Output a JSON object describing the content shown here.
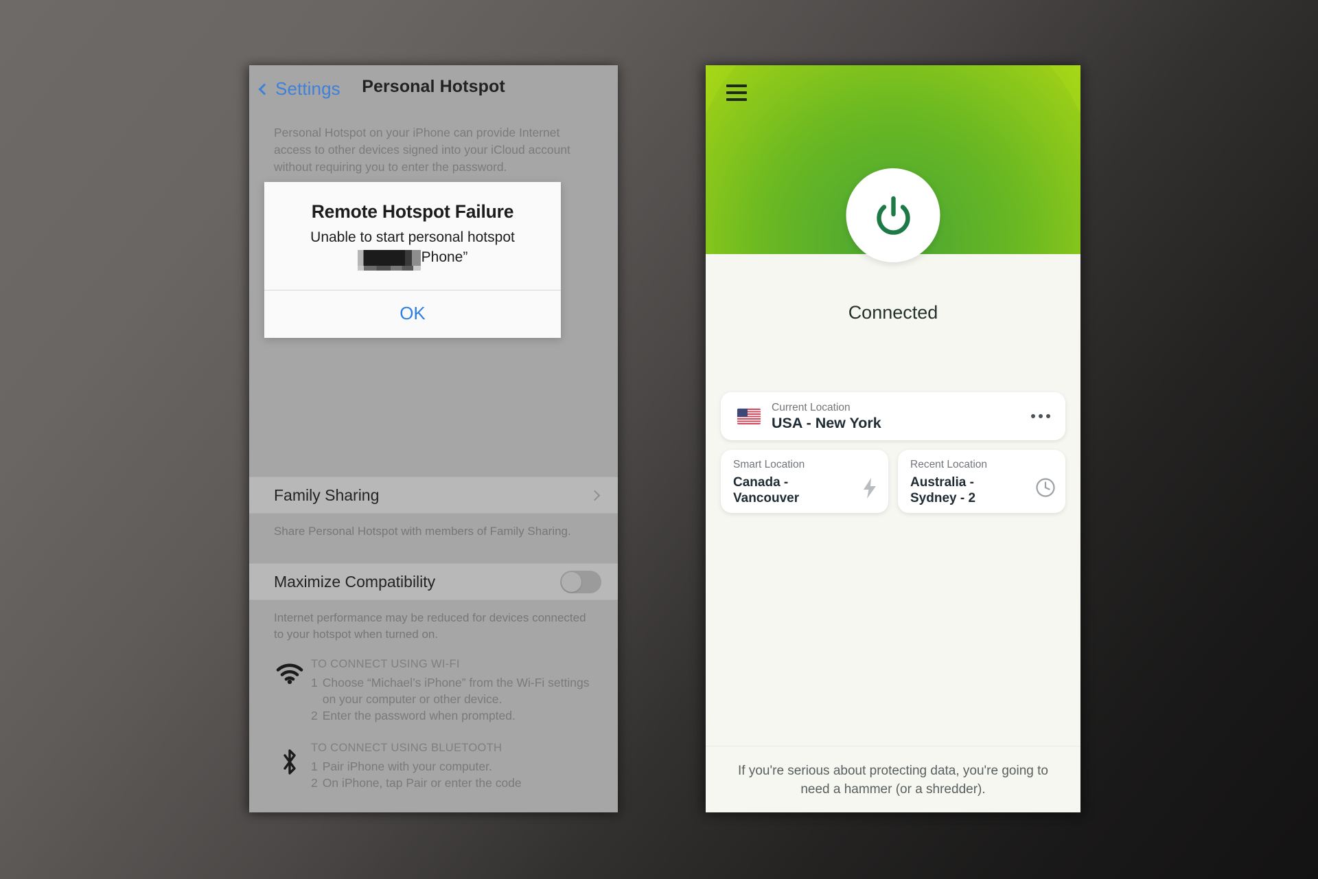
{
  "ios_settings": {
    "nav": {
      "back_label": "Settings",
      "title": "Personal Hotspot",
      "back_icon": "chevron-left-icon"
    },
    "intro": "Personal Hotspot on your iPhone can provide Internet access to other devices signed into your iCloud account without requiring you to enter the password.",
    "alert": {
      "title": "Remote Hotspot Failure",
      "message_line1": "Unable to start personal hotspot",
      "message_line2_suffix": "Phone”",
      "ok_label": "OK"
    },
    "family_sharing": {
      "label": "Family Sharing",
      "footnote": "Share Personal Hotspot with members of Family Sharing."
    },
    "maximize_compatibility": {
      "label": "Maximize Compatibility",
      "toggle_state": "off",
      "footnote": "Internet performance may be reduced for devices connected to your hotspot when turned on."
    },
    "wifi_block": {
      "icon": "wifi-icon",
      "heading": "TO CONNECT USING WI-FI",
      "steps": [
        {
          "num": "1",
          "text": "Choose “Michael’s iPhone” from the Wi-Fi settings on your computer or other device."
        },
        {
          "num": "2",
          "text": "Enter the password when prompted."
        }
      ]
    },
    "bluetooth_block": {
      "icon": "bluetooth-icon",
      "heading": "TO CONNECT USING BLUETOOTH",
      "steps": [
        {
          "num": "1",
          "text": "Pair iPhone with your computer."
        },
        {
          "num": "2",
          "text": "On iPhone, tap Pair or enter the code"
        }
      ]
    }
  },
  "vpn_app": {
    "menu_icon": "hamburger-menu-icon",
    "power_icon": "power-button-icon",
    "status": "Connected",
    "current_location": {
      "label": "Current Location",
      "value": "USA - New York",
      "flag": "usa-flag-icon",
      "more_icon": "more-options-icon"
    },
    "smart_location": {
      "label": "Smart Location",
      "value": "Canada - Vancouver",
      "icon": "lightning-bolt-icon"
    },
    "recent_location": {
      "label": "Recent Location",
      "value": "Australia - Sydney - 2",
      "icon": "clock-icon"
    },
    "footer_tip": "If you're serious about protecting data, you're going to need a hammer (or a shredder)."
  },
  "colors": {
    "ios_accent": "#3f80d8",
    "vpn_green_dark": "#1d7a46",
    "vpn_green_bright": "#b9e02b"
  }
}
